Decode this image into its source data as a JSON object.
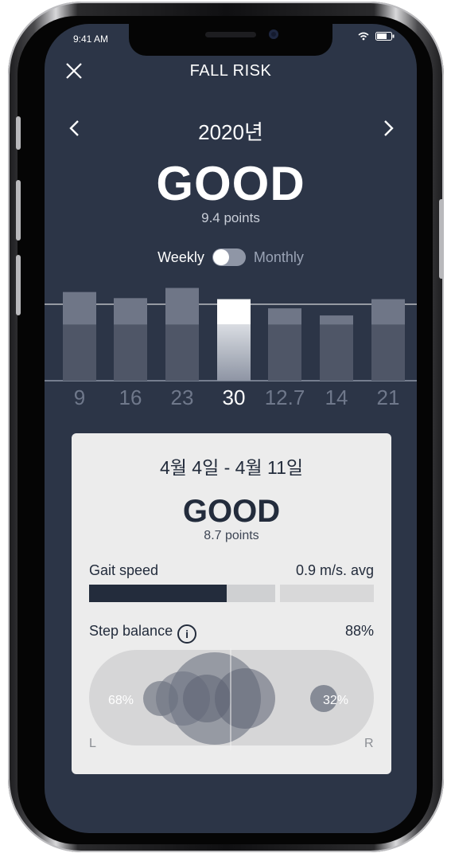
{
  "status_bar": {
    "time": "9:41 AM"
  },
  "header": {
    "title": "FALL RISK"
  },
  "year_nav": {
    "year": "2020년"
  },
  "summary": {
    "status": "GOOD",
    "points": "9.4 points"
  },
  "toggle": {
    "left_label": "Weekly",
    "right_label": "Monthly",
    "selected": "Weekly"
  },
  "chart_data": {
    "type": "bar",
    "categories": [
      "9",
      "16",
      "23",
      "30",
      "12.7",
      "14",
      "21"
    ],
    "values": [
      8.7,
      8.1,
      9.1,
      8.0,
      7.1,
      6.4,
      8.0
    ],
    "selected_index": 3,
    "ylim": [
      0,
      10
    ],
    "baseline": 5.5,
    "grid": false
  },
  "card": {
    "date_range": "4월 4일 - 4월 11일",
    "status": "GOOD",
    "points": "8.7 points",
    "gait_label": "Gait speed",
    "gait_value": "0.9 m/s. avg",
    "gait_progress": 0.74,
    "balance_label": "Step balance",
    "balance_value": "88%",
    "left_pct": "68%",
    "right_pct": "32%",
    "left_letter": "L",
    "right_letter": "R"
  },
  "colors": {
    "background": "#2c3547",
    "card": "#ececec",
    "accent_dark": "#232c3c"
  }
}
